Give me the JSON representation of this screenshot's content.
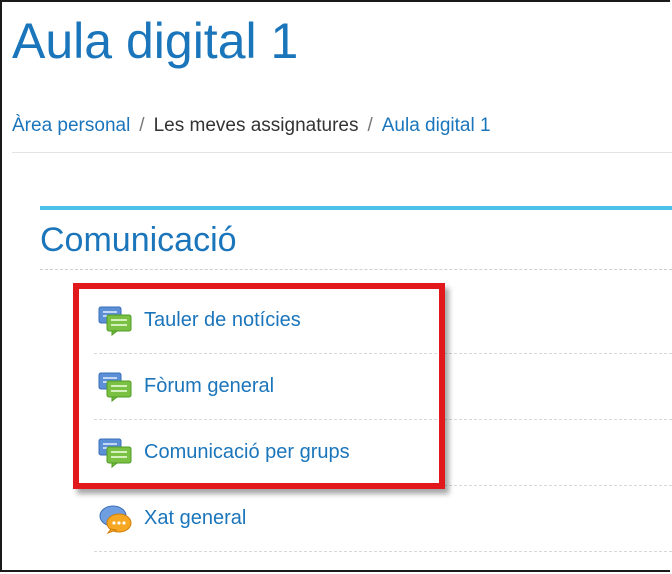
{
  "page": {
    "title": "Aula digital 1"
  },
  "breadcrumb": {
    "items": [
      {
        "label": "Àrea personal"
      },
      {
        "label": "Les meves assignatures"
      },
      {
        "label": "Aula digital 1"
      }
    ],
    "separator": "/"
  },
  "section": {
    "title": "Comunicació",
    "activities": [
      {
        "label": "Tauler de notícies",
        "icon": "forum-icon"
      },
      {
        "label": "Fòrum general",
        "icon": "forum-icon"
      },
      {
        "label": "Comunicació per grups",
        "icon": "forum-icon"
      },
      {
        "label": "Xat general",
        "icon": "chat-icon"
      }
    ]
  },
  "colors": {
    "link": "#1b75bb",
    "section_bar": "#4bc2ea",
    "highlight": "#e1191c"
  }
}
